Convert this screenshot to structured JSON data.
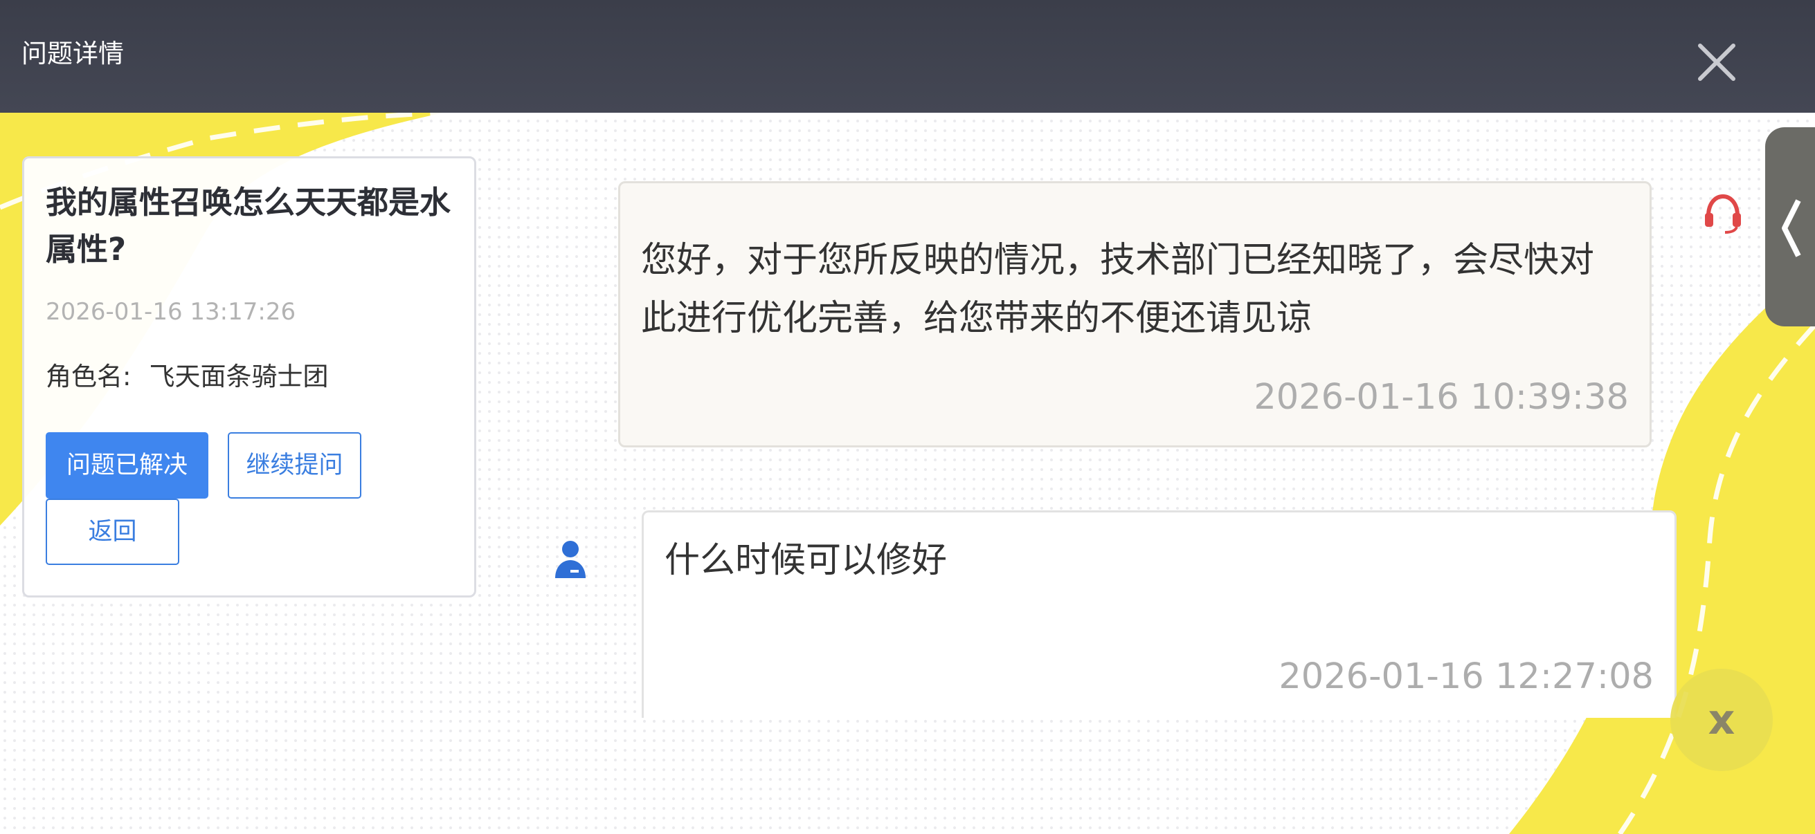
{
  "header": {
    "title": "问题详情",
    "close_icon": "close-icon"
  },
  "question": {
    "title": "我的属性召唤怎么天天都是水属性?",
    "time": "2026-01-16 13:17:26",
    "role_label": "角色名:",
    "role_name": "飞天面条骑士团",
    "buttons": {
      "resolved": "问题已解决",
      "continue": "继续提问",
      "back": "返回"
    }
  },
  "messages": [
    {
      "sender": "support",
      "icon": "headset-icon",
      "text": "您好，对于您所反映的情况，技术部门已经知晓了，会尽快对此进行优化完善，给您带来的不便还请见谅",
      "time": "2026-01-16 10:39:38"
    },
    {
      "sender": "user",
      "icon": "user-icon",
      "text": "什么时候可以修好",
      "time": "2026-01-16 12:27:08"
    }
  ],
  "side_tab": {
    "icon": "chevron-left-icon"
  },
  "float_close": {
    "label": "x"
  },
  "colors": {
    "header_bg": "#3b3e4a",
    "accent_blue": "#3f86ef",
    "yellow": "#f5e63c",
    "support_red": "#e04848",
    "user_icon_blue": "#2f6fd6"
  }
}
